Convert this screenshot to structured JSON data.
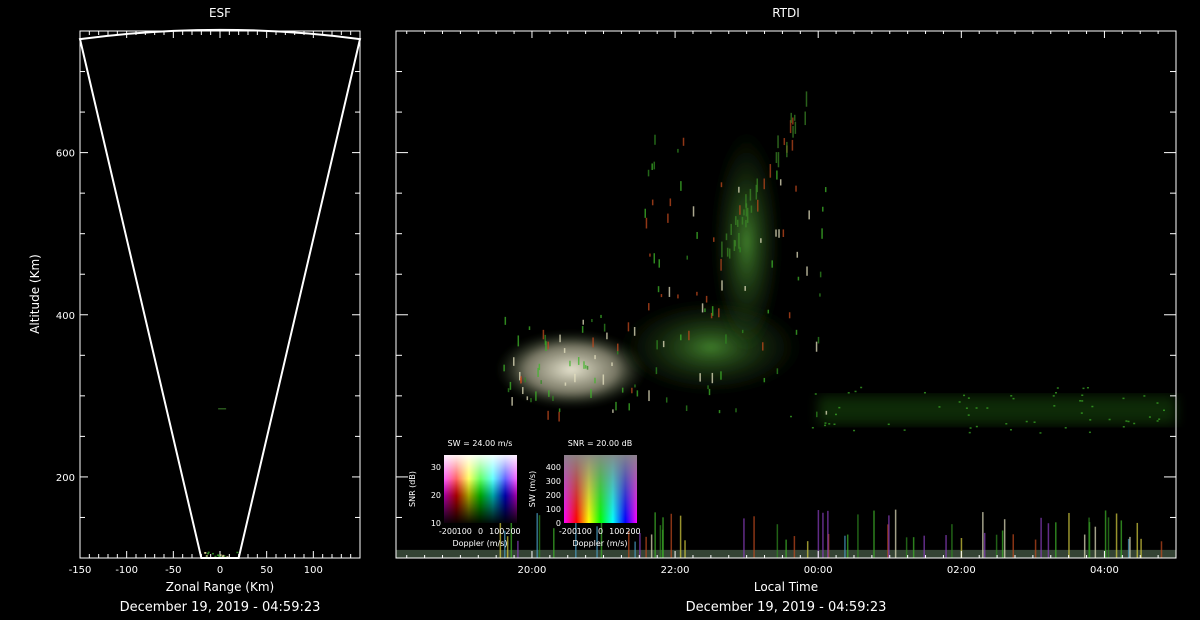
{
  "chart_data": [
    {
      "type": "heatmap",
      "title": "ESF",
      "xlabel": "Zonal Range (Km)",
      "ylabel": "Altitude (Km)",
      "footer": "December 19, 2019 - 04:59:23",
      "xlim": [
        -150,
        150
      ],
      "ylim": [
        100,
        750
      ],
      "x_ticks": [
        -150,
        -100,
        -50,
        0,
        50,
        100
      ],
      "x_tick_labels": [
        "-150",
        "-100",
        "-50",
        "0",
        "50",
        "100"
      ],
      "y_ticks": [
        200,
        400,
        600
      ],
      "y_tick_labels": [
        "200",
        "400",
        "600"
      ],
      "fan_outline": [
        [
          -150,
          740
        ],
        [
          -20,
          100
        ],
        [
          20,
          100
        ],
        [
          150,
          740
        ]
      ],
      "fan_top_apex": [
        0,
        753
      ],
      "grid": false
    },
    {
      "type": "heatmap",
      "title": "RTDI",
      "xlabel": "Local Time",
      "footer": "December 19, 2019 - 04:59:23",
      "x_tick_labels": [
        "20:00",
        "22:00",
        "00:00",
        "02:00",
        "04:00"
      ],
      "xlim_hours": [
        18.1,
        29.0
      ],
      "ylim": [
        100,
        750
      ],
      "y_ticks": [
        200,
        400,
        600
      ],
      "grid": false,
      "features": [
        {
          "kind": "plume",
          "from": [
            19.5,
            285
          ],
          "to": [
            21.6,
            380
          ],
          "color": "#f2efd6"
        },
        {
          "kind": "plume",
          "from": [
            21.2,
            300
          ],
          "to": [
            23.8,
            420
          ],
          "color": "#2f7a1e"
        },
        {
          "kind": "plume",
          "from": [
            22.5,
            350
          ],
          "to": [
            23.5,
            630
          ],
          "color": "#3c8a26"
        },
        {
          "kind": "layer",
          "from": [
            24.0,
            265
          ],
          "to": [
            29.0,
            300
          ],
          "color": "#39a81f"
        },
        {
          "kind": "bottom_band",
          "from": [
            18.1,
            100
          ],
          "to": [
            29.0,
            110
          ],
          "color": "#3a4a3a"
        }
      ],
      "legends": [
        {
          "title": "SW = 24.00 m/s",
          "xlabel": "Doppler (m/s)",
          "ylabel": "SNR (dB)",
          "x_tick_labels": [
            "-200",
            "100",
            "0",
            "100",
            "200"
          ],
          "y_tick_labels": [
            "30",
            "20",
            "10"
          ]
        },
        {
          "title": "SNR = 20.00 dB",
          "xlabel": "Doppler (m/s)",
          "ylabel": "SW (m/s)",
          "x_tick_labels": [
            "-200",
            "100",
            "0",
            "100",
            "200"
          ],
          "y_tick_labels": [
            "400",
            "300",
            "200",
            "100",
            "0"
          ]
        }
      ]
    }
  ]
}
